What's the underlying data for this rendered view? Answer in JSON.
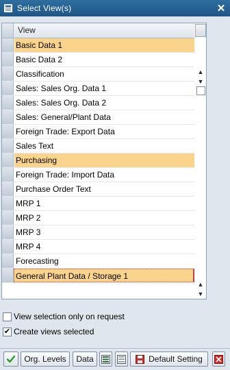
{
  "window": {
    "title": "Select View(s)"
  },
  "table": {
    "column_header": "View",
    "rows": [
      {
        "label": "Basic Data 1",
        "selected": true
      },
      {
        "label": "Basic Data 2",
        "selected": false
      },
      {
        "label": "Classification",
        "selected": false
      },
      {
        "label": "Sales: Sales Org. Data 1",
        "selected": false
      },
      {
        "label": "Sales: Sales Org. Data 2",
        "selected": false
      },
      {
        "label": "Sales: General/Plant Data",
        "selected": false
      },
      {
        "label": "Foreign Trade: Export Data",
        "selected": false
      },
      {
        "label": "Sales Text",
        "selected": false
      },
      {
        "label": "Purchasing",
        "selected": true
      },
      {
        "label": "Foreign Trade: Import Data",
        "selected": false
      },
      {
        "label": "Purchase Order Text",
        "selected": false
      },
      {
        "label": "MRP 1",
        "selected": false
      },
      {
        "label": "MRP 2",
        "selected": false
      },
      {
        "label": "MRP 3",
        "selected": false
      },
      {
        "label": "MRP 4",
        "selected": false
      },
      {
        "label": "Forecasting",
        "selected": false
      },
      {
        "label": "General Plant Data / Storage 1",
        "selected": true
      }
    ]
  },
  "options": {
    "view_selection_label": "View selection only on request",
    "view_selection_checked": false,
    "create_views_label": "Create views selected",
    "create_views_checked": true
  },
  "toolbar": {
    "org_levels_label": "Org. Levels",
    "data_label": "Data",
    "default_setting_label": "Default Setting"
  },
  "colors": {
    "selected_row": "#fad38d",
    "titlebar": "#1d5585"
  },
  "icons": {
    "enter": "check-icon",
    "select_all": "select-all-icon",
    "deselect_all": "deselect-all-icon",
    "save": "save-icon",
    "cancel": "cancel-icon"
  }
}
